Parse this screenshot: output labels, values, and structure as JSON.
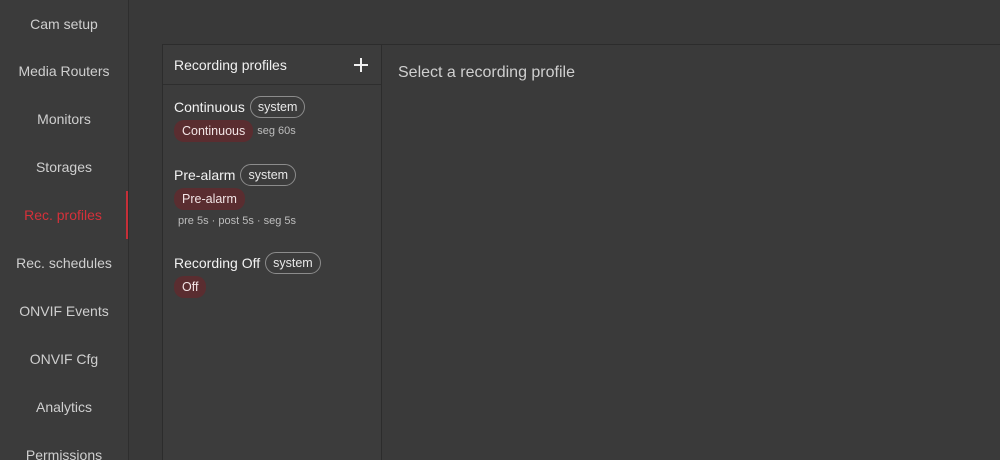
{
  "sidebar": {
    "items": [
      {
        "label": "Cam setup"
      },
      {
        "label": "Media Routers"
      },
      {
        "label": "Monitors"
      },
      {
        "label": "Storages"
      },
      {
        "label": "Rec. profiles",
        "active": true
      },
      {
        "label": "Rec. schedules"
      },
      {
        "label": "ONVIF Events"
      },
      {
        "label": "ONVIF Cfg"
      },
      {
        "label": "Analytics"
      },
      {
        "label": "Permissions"
      }
    ]
  },
  "profiles": {
    "title": "Recording profiles",
    "add_icon": "plus-icon",
    "items": [
      {
        "name": "Continuous",
        "badge": "system",
        "mode": "Continuous",
        "meta": "seg 60s"
      },
      {
        "name": "Pre-alarm",
        "badge": "system",
        "mode": "Pre-alarm",
        "meta": "pre 5s · post 5s · seg 5s"
      },
      {
        "name": "Recording Off",
        "badge": "system",
        "mode": "Off",
        "meta": ""
      }
    ]
  },
  "detail": {
    "placeholder": "Select a recording profile"
  },
  "colors": {
    "accent": "#d5313a",
    "tag_bg": "#5a2d30",
    "background": "#3a3a3a"
  }
}
